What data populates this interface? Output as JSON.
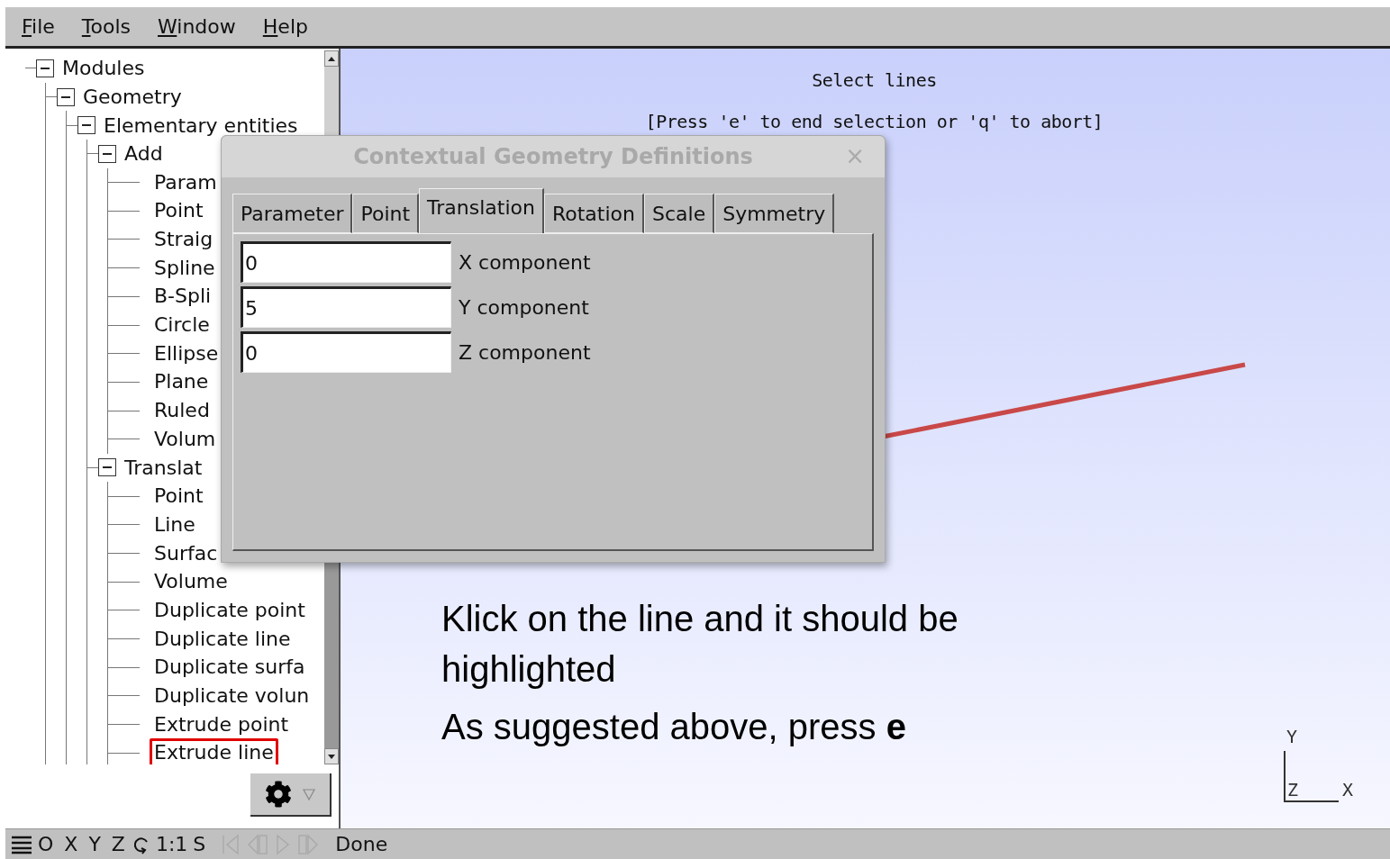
{
  "menu": [
    {
      "label": "File"
    },
    {
      "label": "Tools"
    },
    {
      "label": "Window"
    },
    {
      "label": "Help"
    }
  ],
  "tree": [
    {
      "label": "Modules",
      "expanded": true,
      "children": [
        {
          "label": "Geometry",
          "expanded": true,
          "children": [
            {
              "label": "Elementary entities",
              "expanded": true,
              "children": [
                {
                  "label": "Add",
                  "expanded": true,
                  "children": [
                    {
                      "label": "Param",
                      "highlighted": false
                    },
                    {
                      "label": "Point",
                      "highlighted": false
                    },
                    {
                      "label": "Straig",
                      "highlighted": false
                    },
                    {
                      "label": "Spline",
                      "highlighted": false
                    },
                    {
                      "label": "B-Spli",
                      "highlighted": false
                    },
                    {
                      "label": "Circle",
                      "highlighted": false
                    },
                    {
                      "label": "Ellipse",
                      "highlighted": false
                    },
                    {
                      "label": "Plane",
                      "highlighted": false
                    },
                    {
                      "label": "Ruled",
                      "highlighted": false
                    },
                    {
                      "label": "Volum",
                      "highlighted": false
                    }
                  ]
                },
                {
                  "label": "Translat",
                  "expanded": true,
                  "children": [
                    {
                      "label": "Point",
                      "highlighted": false
                    },
                    {
                      "label": "Line",
                      "highlighted": false
                    },
                    {
                      "label": "Surfac",
                      "highlighted": false
                    },
                    {
                      "label": "Volume",
                      "highlighted": false
                    },
                    {
                      "label": "Duplicate point",
                      "highlighted": false
                    },
                    {
                      "label": "Duplicate line",
                      "highlighted": false
                    },
                    {
                      "label": "Duplicate surfa",
                      "highlighted": false
                    },
                    {
                      "label": "Duplicate volun",
                      "highlighted": false
                    },
                    {
                      "label": "Extrude point",
                      "highlighted": false
                    },
                    {
                      "label": "Extrude line",
                      "highlighted": true
                    }
                  ]
                }
              ]
            }
          ]
        }
      ]
    }
  ],
  "viewport": {
    "messages": [
      "Select lines",
      "[Press 'e' to end selection or 'q' to abort]"
    ],
    "annotation": [
      "Klick on the line and it should be highlighted",
      "As suggested above, press **e**"
    ],
    "axes": {
      "y": "Y",
      "z": "Z",
      "x": "X"
    }
  },
  "dialog": {
    "title": "Contextual Geometry Definitions",
    "close": "×",
    "tabs": [
      {
        "label": "Parameter",
        "selected": false
      },
      {
        "label": "Point",
        "selected": false
      },
      {
        "label": "Translation",
        "selected": true
      },
      {
        "label": "Rotation",
        "selected": false
      },
      {
        "label": "Scale",
        "selected": false
      },
      {
        "label": "Symmetry",
        "selected": false
      }
    ],
    "fields": [
      {
        "value": "0",
        "label": "X component"
      },
      {
        "value": "5",
        "label": "Y component"
      },
      {
        "value": "0",
        "label": "Z component"
      }
    ]
  },
  "status_bar": {
    "axis_buttons": [
      "O",
      "X",
      "Y",
      "Z"
    ],
    "scale": "1:1",
    "snapshot": "S",
    "message": "Done"
  }
}
